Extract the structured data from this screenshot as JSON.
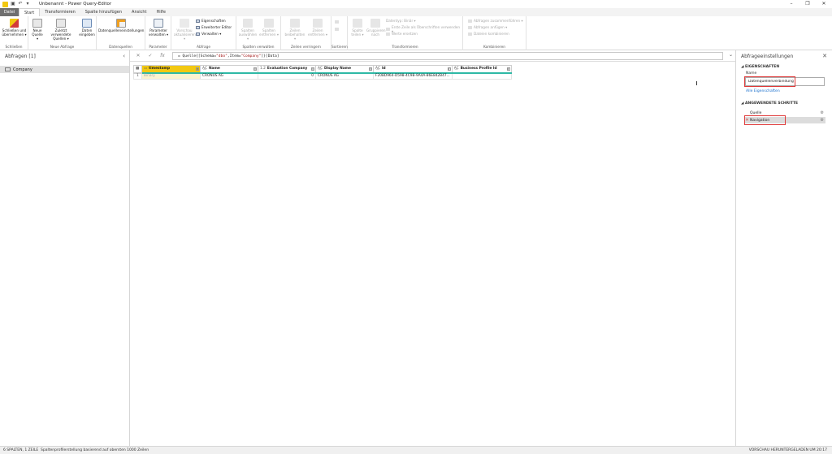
{
  "titlebar": {
    "title": "Unbenannt - Power Query-Editor",
    "minimize": "–",
    "maximize": "❐",
    "close": "✕"
  },
  "menu": {
    "tabs": [
      "Datei",
      "Start",
      "Transformieren",
      "Spalte hinzufügen",
      "Ansicht",
      "Hilfe"
    ]
  },
  "ribbon": {
    "groups": {
      "close": {
        "label": "Schließen",
        "btn": "Schließen und übernehmen ▾"
      },
      "new_query": {
        "label": "Neue Abfrage",
        "new_source": "Neue Quelle ▾",
        "recent": "Zuletzt verwendete Quellen ▾",
        "enter_data": "Daten eingeben"
      },
      "data_sources": {
        "label": "Datenquellen",
        "settings": "Datenquelleneinstellungen"
      },
      "parameters": {
        "label": "Parameter",
        "manage": "Parameter verwalten ▾"
      },
      "query": {
        "label": "Abfrage",
        "refresh": "Vorschau aktualisieren ▾",
        "properties": "Eigenschaften",
        "adv_editor": "Erweiterter Editor",
        "manage": "Verwalten ▾"
      },
      "manage_columns": {
        "label": "Spalten verwalten",
        "choose": "Spalten auswählen ▾",
        "remove": "Spalten entfernen ▾"
      },
      "reduce_rows": {
        "label": "Zeilen verringern",
        "keep": "Zeilen beibehalten ▾",
        "remove": "Zeilen entfernen ▾"
      },
      "sort": {
        "label": "Sortieren"
      },
      "transform": {
        "label": "Transformieren",
        "split": "Spalte teilen ▾",
        "group": "Gruppieren nach",
        "datatype": "Datentyp: Binär ▾",
        "headers": "Erste Zeile als Überschriften verwenden ▾",
        "replace": "Werte ersetzen"
      },
      "combine": {
        "label": "Kombinieren",
        "merge": "Abfragen zusammenführen ▾",
        "append": "Abfragen anfügen ▾",
        "combine_files": "Dateien kombinieren"
      }
    }
  },
  "queries": {
    "header": "Abfragen [1]",
    "items": [
      {
        "label": "Company"
      }
    ]
  },
  "formula": {
    "cancel": "✕",
    "commit": "✓",
    "fx": "fx",
    "prefix": "= Quelle{[Schema=",
    "schema": "\"dbo\"",
    "mid": ",Item=",
    "item": "\"Company\"",
    "suffix": "]}[Data]",
    "expand": "⌄"
  },
  "table": {
    "columns": [
      {
        "type": "▭",
        "name": "timestamp"
      },
      {
        "type": "A͜C",
        "name": "Name"
      },
      {
        "type": "1.2",
        "name": "Evaluation Company"
      },
      {
        "type": "A͜C",
        "name": "Display Name"
      },
      {
        "type": "A͜C",
        "name": "Id"
      },
      {
        "type": "A͜C",
        "name": "Business Profile Id"
      }
    ],
    "rows": [
      {
        "num": "1",
        "cells": [
          "Binary",
          "CRONUS AG",
          "0",
          "CRONUS AG",
          "F20BD964-D598-4C9B-9A4A-86E842B47...",
          ""
        ]
      }
    ]
  },
  "settings": {
    "header": "Abfrageeinstellungen",
    "properties_title": "EIGENSCHAFTEN",
    "name_label": "Name",
    "name_value": "Datenquellenverbindung",
    "all_properties": "Alle Eigenschaften",
    "steps_title": "ANGEWENDETE SCHRITTE",
    "steps": [
      "Quelle",
      "Navigation"
    ]
  },
  "status": {
    "left1": "6 SPALTEN, 1 ZEILE",
    "left2": "Spaltenprofilerstellung basierend auf obersten 1000 Zeilen",
    "right": "VORSCHAU HERUNTERGELADEN UM 20:17"
  },
  "colors": {
    "accent": "#f2c811",
    "teal": "#2eb9a6",
    "highlight": "#e03a3a",
    "link": "#1a6fcd"
  }
}
